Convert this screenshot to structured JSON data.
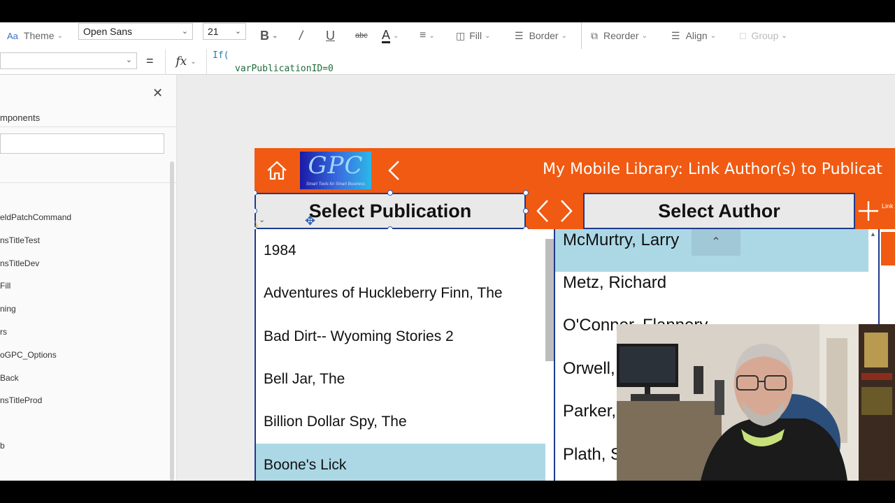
{
  "ribbon": {
    "theme_label": "Theme",
    "font_value": "Open Sans",
    "size_value": "21",
    "fill_label": "Fill",
    "border_label": "Border",
    "reorder_label": "Reorder",
    "align_label": "Align",
    "group_label": "Group"
  },
  "formula": {
    "equals": "=",
    "fx": "fx",
    "line1": "If(",
    "line2": "varPublicationID=0"
  },
  "left_panel": {
    "title": "mponents",
    "items": [
      "eldPatchCommand",
      "nsTitleTest",
      "nsTitleDev",
      "Fill",
      "ning",
      "rs",
      "oGPC_Options",
      "Back",
      "nsTitleProd",
      "b"
    ]
  },
  "app": {
    "logo_text": "GPC",
    "logo_tagline": "Smart Tools for Smart Business",
    "title": "My Mobile Library:  Link Author(s) to Publicat",
    "select_publication": "Select Publication",
    "select_author": "Select Author",
    "link_label": "Link",
    "publications": [
      "1984",
      "Adventures of Huckleberry Finn, The",
      "Bad Dirt-- Wyoming Stories 2",
      "Bell Jar, The",
      "Billion Dollar Spy, The",
      "Boone's Lick"
    ],
    "authors": [
      "McMurtry, Larry",
      "Metz, Richard",
      "O'Connor, Flannery",
      "Orwell, George",
      "Parker, Robert B.",
      "Plath, Sylvia"
    ],
    "colors": {
      "header": "#f05a12",
      "selected_row": "#acd8e6",
      "border": "#1f3a8c"
    }
  }
}
